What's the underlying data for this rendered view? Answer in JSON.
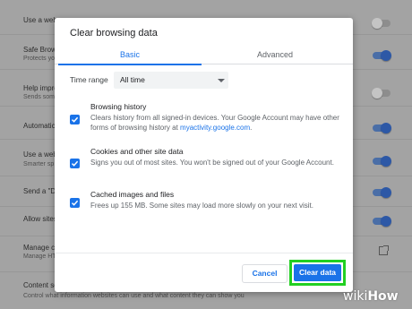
{
  "background": {
    "rows": [
      {
        "title": "Use a web",
        "sub": "",
        "toggle": "off"
      },
      {
        "title": "Safe Brows",
        "sub": "Protects yo",
        "toggle": "on"
      },
      {
        "title": "Help impro",
        "sub": "Sends som",
        "toggle": "off"
      },
      {
        "title": "Automatic",
        "sub": "",
        "toggle": "on"
      },
      {
        "title": "Use a web",
        "sub": "Smarter sp",
        "toggle": "on"
      },
      {
        "title": "Send a \"Do",
        "sub": "",
        "toggle": "on"
      },
      {
        "title": "Allow sites",
        "sub": "",
        "toggle": "on"
      },
      {
        "title": "Manage ce",
        "sub": "Manage HT",
        "toggle": "none"
      },
      {
        "title": "Content se",
        "sub": "Control what information websites can use and what content they can show you",
        "toggle": "none"
      }
    ]
  },
  "dialog": {
    "title": "Clear browsing data",
    "tabs": [
      {
        "label": "Basic",
        "active": true
      },
      {
        "label": "Advanced",
        "active": false
      }
    ],
    "time_range": {
      "label": "Time range",
      "value": "All time"
    },
    "options": [
      {
        "title": "Browsing history",
        "desc": "Clears history from all signed-in devices. Your Google Account may have other forms of browsing history at",
        "link": "myactivity.google.com",
        "desc_end": ".",
        "checked": true
      },
      {
        "title": "Cookies and other site data",
        "desc": "Signs you out of most sites. You won't be signed out of your Google Account.",
        "checked": true
      },
      {
        "title": "Cached images and files",
        "desc": "Frees up 155 MB. Some sites may load more slowly on your next visit.",
        "checked": true
      }
    ],
    "buttons": {
      "cancel": "Cancel",
      "clear": "Clear data"
    }
  },
  "watermark": {
    "wiki": "wiki",
    "how": "How"
  },
  "colors": {
    "accent": "#1a73e8",
    "highlight": "#22d022"
  }
}
